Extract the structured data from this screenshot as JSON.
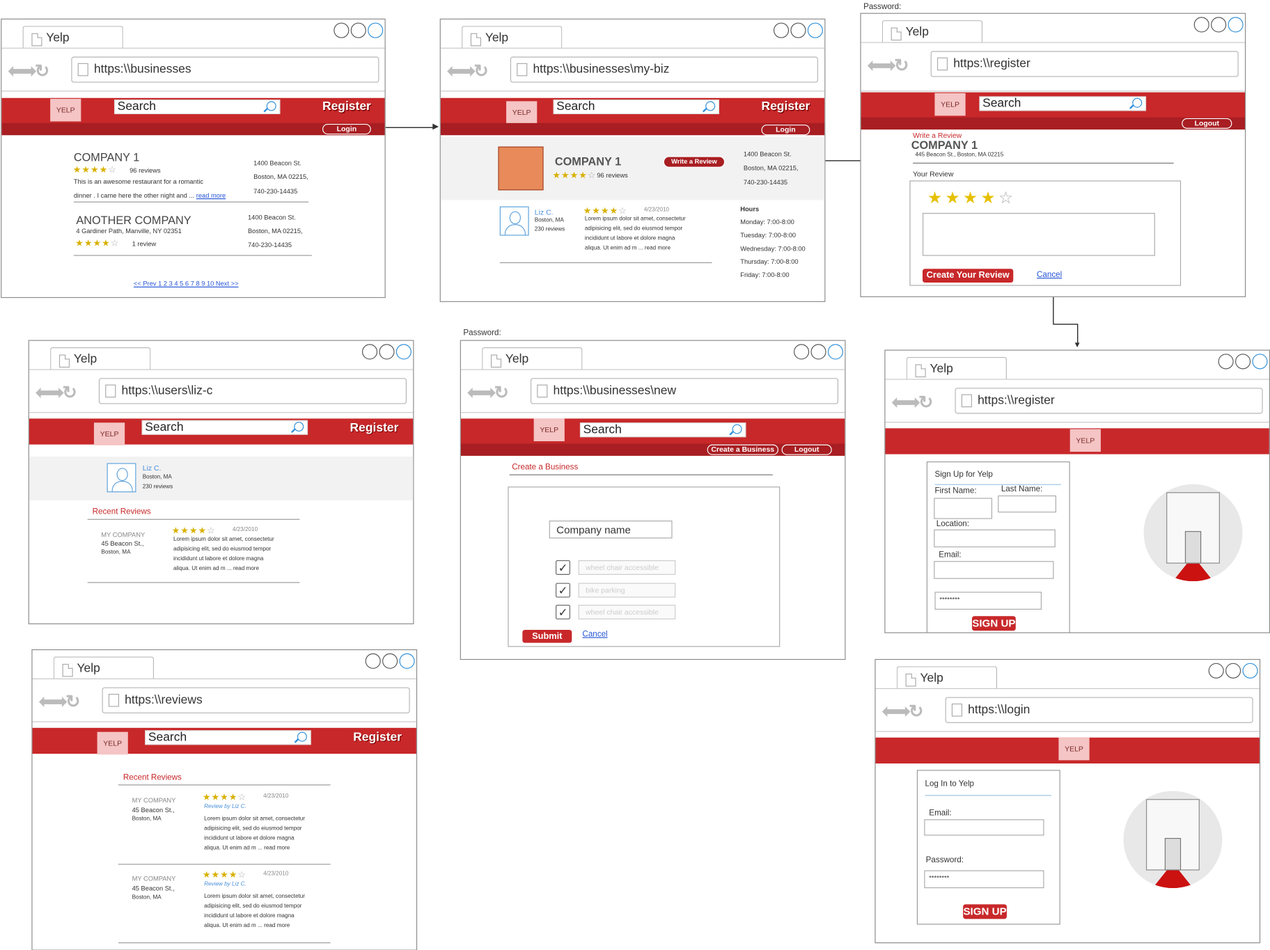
{
  "common": {
    "tab_title": "Yelp",
    "logo": "YELP",
    "search": "Search",
    "register": "Register",
    "login": "Login",
    "logout": "Logout",
    "password_caption": "Password:"
  },
  "w1": {
    "url": "https:\\\\businesses",
    "b1": {
      "name": "COMPANY 1",
      "reviews": "96 reviews",
      "desc1": "This is an awesome restaurant for a romantic",
      "desc2": "dinner . I came here the other night and ...",
      "readmore": "read more",
      "addr1": "1400 Beacon St.",
      "addr2": "Boston, MA 02215,",
      "phone": "740-230-14435"
    },
    "b2": {
      "name": "ANOTHER COMPANY",
      "street": "4 Gardiner Path, Manville, NY 02351",
      "reviews": "1 review",
      "addr1": "1400 Beacon St.",
      "addr2": "Boston, MA 02215,",
      "phone": "740-230-14435"
    },
    "pager": "<< Prev 1 2 3 4 5 6 7 8 9 10 Next >>"
  },
  "w2": {
    "url": "https:\\\\businesses\\my-biz",
    "name": "COMPANY 1",
    "write": "Write a Review",
    "reviews": "96 reviews",
    "addr1": "1400 Beacon St.",
    "addr2": "Boston, MA 02215,",
    "phone": "740-230-14435",
    "reviewer": "Liz C.",
    "rloc": "Boston, MA",
    "rcount": "230 reviews",
    "date": "4/23/2010",
    "l1": "Lorem ipsum dolor sit amet, consectetur",
    "l2": "adipisicing elit, sed do eiusmod tempor",
    "l3": "incididunt ut labore et dolore magna",
    "l4": "aliqua. Ut enim ad m ... read more",
    "hours_title": "Hours",
    "h1": "Monday: 7:00-8:00",
    "h2": "Tuesday: 7:00-8:00",
    "h3": "Wednesday: 7:00-8:00",
    "h4": "Thursday: 7:00-8:00",
    "h5": "Friday: 7:00-8:00"
  },
  "w3": {
    "url": "https:\\\\register",
    "write": "Write a Review",
    "name": "COMPANY 1",
    "addr": "445 Beacon St., Boston, MA 02215",
    "your_review": "Your Review",
    "create": "Create Your Review",
    "cancel": "Cancel"
  },
  "w4": {
    "url": "https:\\\\users\\liz-c",
    "reviewer": "Liz C.",
    "rloc": "Boston, MA",
    "rcount": "230 reviews",
    "recent": "Recent Reviews",
    "co": "MY COMPANY",
    "street": "45 Beacon St.,",
    "city": "Boston, MA",
    "date": "4/23/2010",
    "l1": "Lorem ipsum dolor sit amet, consectetur",
    "l2": "adipisicing elit, sed do eiusmod tempor",
    "l3": "incididunt ut labore et dolore magna",
    "l4": "aliqua. Ut enim ad m ... read more"
  },
  "w5": {
    "url": "https:\\\\businesses\\new",
    "create_biz": "Create a Business",
    "title": "Create a Business",
    "company_name": "Company name",
    "c1": "wheel chair accessible",
    "c2": "bike parking",
    "c3": "wheel chair accessible",
    "submit": "Submit",
    "cancel": "Cancel"
  },
  "w6": {
    "url": "https:\\\\register",
    "title": "Sign Up for Yelp",
    "first": "First Name:",
    "last": "Last Name:",
    "location": "Location:",
    "email": "Email:",
    "pw": "********",
    "signup": "SIGN UP"
  },
  "w7": {
    "url": "https:\\\\reviews",
    "recent": "Recent Reviews",
    "co": "MY COMPANY",
    "street": "45 Beacon St.,",
    "city": "Boston, MA",
    "date": "4/23/2010",
    "by": "Review by Liz C.",
    "l1": "Lorem ipsum dolor sit amet, consectetur",
    "l2": "adipisicing elit, sed do eiusmod tempor",
    "l3": "incididunt ut labore et dolore magna",
    "l4": "aliqua. Ut enim ad m ... read more"
  },
  "w8": {
    "url": "https:\\\\login",
    "title": "Log In to Yelp",
    "email": "Email:",
    "password": "Password:",
    "pw": "********",
    "signup": "SIGN UP"
  }
}
